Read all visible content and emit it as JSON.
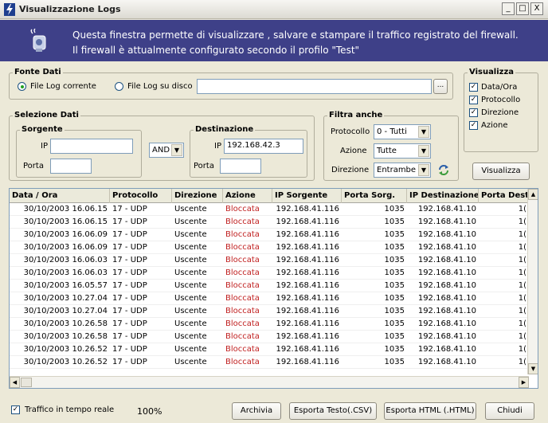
{
  "window": {
    "title": "Visualizzazione Logs",
    "controls": [
      "_",
      "□",
      "X"
    ]
  },
  "banner": {
    "line1": "Questa finestra permette di visualizzare , salvare e stampare il traffico registrato del firewall.",
    "line2": "Il firewall è attualmente configurato secondo il profilo \"Test\""
  },
  "fonte_dati": {
    "title": "Fonte Dati",
    "option_current": "File Log corrente",
    "option_disk": "File Log su disco",
    "path_value": "",
    "browse_label": "..."
  },
  "visualizza": {
    "title": "Visualizza",
    "checks": [
      "Data/Ora",
      "Protocollo",
      "Direzione",
      "Azione"
    ],
    "button_label": "Visualizza"
  },
  "selezione": {
    "title": "Selezione Dati",
    "sorgente": {
      "title": "Sorgente",
      "ip_label": "IP",
      "ip_value": "",
      "porta_label": "Porta",
      "porta_value": ""
    },
    "operator": "AND",
    "destinazione": {
      "title": "Destinazione",
      "ip_label": "IP",
      "ip_value": "192.168.42.3",
      "porta_label": "Porta",
      "porta_value": ""
    }
  },
  "filtra": {
    "title": "Filtra anche",
    "protocollo_label": "Protocollo",
    "protocollo_value": "0 - Tutti",
    "azione_label": "Azione",
    "azione_value": "Tutte",
    "direzione_label": "Direzione",
    "direzione_value": "Entrambe"
  },
  "grid": {
    "columns": [
      "Data / Ora",
      "Protocollo",
      "Direzione",
      "Azione",
      "IP Sorgente",
      "Porta Sorg.",
      "IP Destinazione",
      "Porta Dest."
    ],
    "rows": [
      [
        "30/10/2003 16.06.15",
        "17 - UDP",
        "Uscente",
        "Bloccata",
        "192.168.41.116",
        "1035",
        "192.168.41.10",
        "1("
      ],
      [
        "30/10/2003 16.06.15",
        "17 - UDP",
        "Uscente",
        "Bloccata",
        "192.168.41.116",
        "1035",
        "192.168.41.10",
        "1("
      ],
      [
        "30/10/2003 16.06.09",
        "17 - UDP",
        "Uscente",
        "Bloccata",
        "192.168.41.116",
        "1035",
        "192.168.41.10",
        "1("
      ],
      [
        "30/10/2003 16.06.09",
        "17 - UDP",
        "Uscente",
        "Bloccata",
        "192.168.41.116",
        "1035",
        "192.168.41.10",
        "1("
      ],
      [
        "30/10/2003 16.06.03",
        "17 - UDP",
        "Uscente",
        "Bloccata",
        "192.168.41.116",
        "1035",
        "192.168.41.10",
        "1("
      ],
      [
        "30/10/2003 16.06.03",
        "17 - UDP",
        "Uscente",
        "Bloccata",
        "192.168.41.116",
        "1035",
        "192.168.41.10",
        "1("
      ],
      [
        "30/10/2003 16.05.57",
        "17 - UDP",
        "Uscente",
        "Bloccata",
        "192.168.41.116",
        "1035",
        "192.168.41.10",
        "1("
      ],
      [
        "30/10/2003 10.27.04",
        "17 - UDP",
        "Uscente",
        "Bloccata",
        "192.168.41.116",
        "1035",
        "192.168.41.10",
        "1("
      ],
      [
        "30/10/2003 10.27.04",
        "17 - UDP",
        "Uscente",
        "Bloccata",
        "192.168.41.116",
        "1035",
        "192.168.41.10",
        "1("
      ],
      [
        "30/10/2003 10.26.58",
        "17 - UDP",
        "Uscente",
        "Bloccata",
        "192.168.41.116",
        "1035",
        "192.168.41.10",
        "1("
      ],
      [
        "30/10/2003 10.26.58",
        "17 - UDP",
        "Uscente",
        "Bloccata",
        "192.168.41.116",
        "1035",
        "192.168.41.10",
        "1("
      ],
      [
        "30/10/2003 10.26.52",
        "17 - UDP",
        "Uscente",
        "Bloccata",
        "192.168.41.116",
        "1035",
        "192.168.41.10",
        "1("
      ],
      [
        "30/10/2003 10.26.52",
        "17 - UDP",
        "Uscente",
        "Bloccata",
        "192.168.41.116",
        "1035",
        "192.168.41.10",
        "1("
      ]
    ]
  },
  "statusbar": {
    "realtime_label": "Traffico in tempo reale",
    "percent": "100%",
    "archivia": "Archivia",
    "esporta_testo": "Esporta Testo(.CSV)",
    "esporta_html": "Esporta HTML (.HTML)",
    "chiudi": "Chiudi"
  },
  "colors": {
    "banner": "#3e4088",
    "blocked": "#c02020",
    "window": "#ece9d8"
  }
}
